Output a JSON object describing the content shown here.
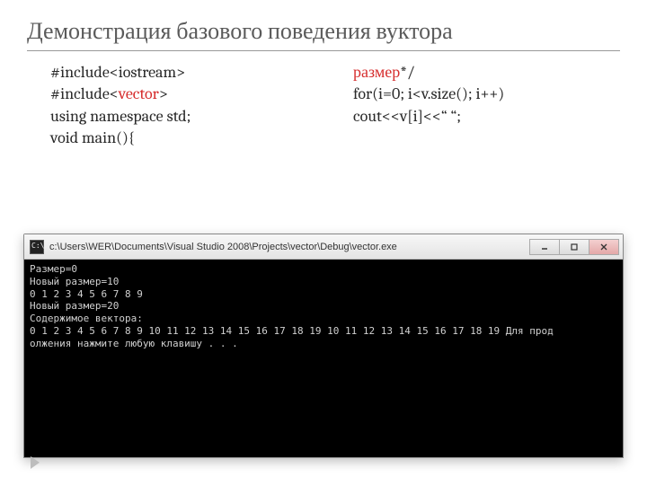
{
  "title": "Демонстрация базового поведения вуктора",
  "code": {
    "left": {
      "l1a": "#include<iostream>",
      "l2a": "#include<",
      "l2b": "vector",
      "l2c": ">",
      "l3": "using namespace std;",
      "l4": "",
      "l5": "void main(){"
    },
    "right": {
      "l1a": "размер",
      "l1b": "*/",
      "l2": "",
      "l3": "for(i=0; i<v.size(); i++)",
      "l4": "cout<<v[i]<<“ “;"
    }
  },
  "console": {
    "path": "c:\\Users\\WER\\Documents\\Visual Studio 2008\\Projects\\vector\\Debug\\vector.exe",
    "lines": [
      "Размер=0",
      "Новый размер=10",
      "0 1 2 3 4 5 6 7 8 9",
      "Новый размер=20",
      "Содержимое вектора:",
      "0 1 2 3 4 5 6 7 8 9 10 11 12 13 14 15 16 17 18 19 10 11 12 13 14 15 16 17 18 19 Для прод",
      "олжения нажмите любую клавишу . . ."
    ]
  }
}
